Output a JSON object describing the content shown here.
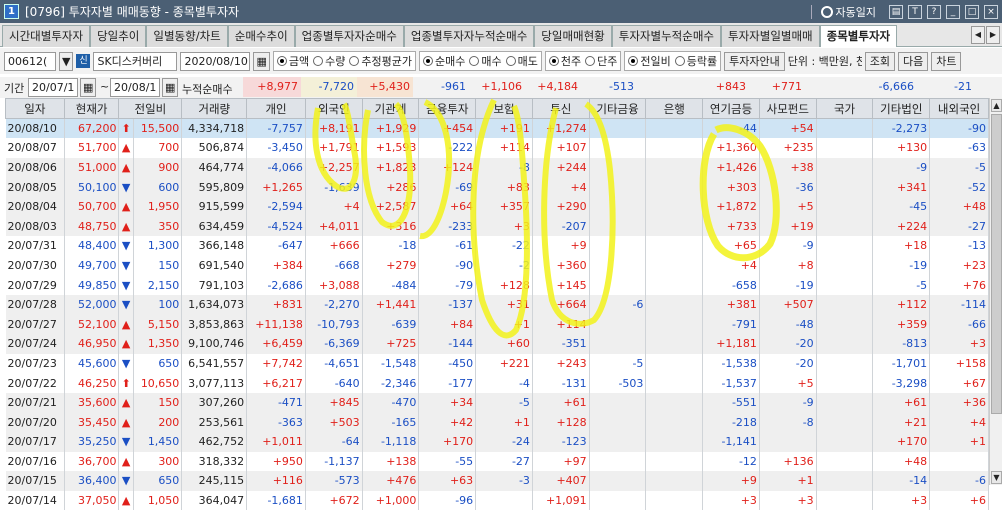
{
  "window": {
    "number": "1",
    "title": "[0796] 투자자별 매매동향 - 종목별투자자",
    "autolog": "자동일지",
    "buttons": [
      "T",
      "?",
      "_",
      "□",
      "×"
    ]
  },
  "tabs": [
    "시간대별투자자",
    "당일추이",
    "일별동향/차트",
    "순매수추이",
    "업종별투자자순매수",
    "업종별투자자누적순매수",
    "당일매매현황",
    "투자자별누적순매수",
    "투자자별일별매매",
    "종목별투자자"
  ],
  "active_tab": "종목별투자자",
  "controls": {
    "code": "00612(",
    "sin": "신",
    "stock_name": "SK디스커버리",
    "date": "2020/08/10",
    "mode_radios": [
      {
        "label": "금액",
        "on": true
      },
      {
        "label": "수량",
        "on": false
      },
      {
        "label": "추정평균가",
        "on": false
      }
    ],
    "side_radios": [
      {
        "label": "순매수",
        "on": true
      },
      {
        "label": "매수",
        "on": false
      },
      {
        "label": "매도",
        "on": false
      }
    ],
    "unit_radios": [
      {
        "label": "천주",
        "on": true
      },
      {
        "label": "단주",
        "on": false
      }
    ],
    "compare_radios": [
      {
        "label": "전일비",
        "on": true
      },
      {
        "label": "등락률",
        "on": false
      }
    ],
    "guide_btn": "투자자안내",
    "unit_text": "단위 : 백만원, 천주",
    "lookup_btn": "조회",
    "next_btn": "다음",
    "chart_btn": "차트"
  },
  "period": {
    "label": "기간",
    "from": "20/07/1",
    "to": "20/08/1",
    "net_label": "누적순매수"
  },
  "net_sums": [
    {
      "col": "개인",
      "v": "+8,977"
    },
    {
      "col": "외국인",
      "v": "-7,720"
    },
    {
      "col": "기관계",
      "v": "+5,430"
    },
    {
      "col": "금융투자",
      "v": "-961"
    },
    {
      "col": "보험",
      "v": "+1,106"
    },
    {
      "col": "투신",
      "v": "+4,184"
    },
    {
      "col": "기타금융",
      "v": "-513"
    },
    {
      "col": "은행",
      "v": ""
    },
    {
      "col": "연기금등",
      "v": "+843"
    },
    {
      "col": "사모펀드",
      "v": "+771"
    },
    {
      "col": "국가",
      "v": ""
    },
    {
      "col": "기타법인",
      "v": "-6,666"
    },
    {
      "col": "내외국인",
      "v": "-21"
    }
  ],
  "headers": [
    "일자",
    "현재가",
    "전일비",
    "거래량",
    "개인",
    "외국인",
    "기관계",
    "금융투자",
    "보험",
    "투신",
    "기타금융",
    "은행",
    "연기금등",
    "사모펀드",
    "국가",
    "기타법인",
    "내외국인"
  ],
  "rows": [
    [
      "20/08/10",
      "67,200",
      "up",
      "15,500",
      "4,334,718",
      "-7,757",
      "+8,191",
      "+1,929",
      "+454",
      "+191",
      "+1,274",
      "",
      "",
      "-44",
      "+54",
      "",
      "-2,273",
      "-90"
    ],
    [
      "20/08/07",
      "51,700",
      "upt",
      "700",
      "506,874",
      "-3,450",
      "+1,791",
      "+1,593",
      "-222",
      "+114",
      "+107",
      "",
      "",
      "+1,360",
      "+235",
      "",
      "+130",
      "-63"
    ],
    [
      "20/08/06",
      "51,000",
      "upt",
      "900",
      "464,774",
      "-4,066",
      "+2,257",
      "+1,823",
      "+124",
      "-8",
      "+244",
      "",
      "",
      "+1,426",
      "+38",
      "",
      "-9",
      "-5"
    ],
    [
      "20/08/05",
      "50,100",
      "dn",
      "600",
      "595,809",
      "+1,265",
      "-1,639",
      "+286",
      "-69",
      "+83",
      "+4",
      "",
      "",
      "+303",
      "-36",
      "",
      "+341",
      "-52"
    ],
    [
      "20/08/04",
      "50,700",
      "upt",
      "1,950",
      "915,599",
      "-2,594",
      "+4",
      "+2,587",
      "+64",
      "+357",
      "+290",
      "",
      "",
      "+1,872",
      "+5",
      "",
      "-45",
      "+48"
    ],
    [
      "20/08/03",
      "48,750",
      "upt",
      "350",
      "634,459",
      "-4,524",
      "+4,011",
      "+316",
      "-233",
      "+3",
      "-207",
      "",
      "",
      "+733",
      "+19",
      "",
      "+224",
      "-27"
    ],
    [
      "20/07/31",
      "48,400",
      "dn",
      "1,300",
      "366,148",
      "-647",
      "+666",
      "-18",
      "-61",
      "-22",
      "+9",
      "",
      "",
      "+65",
      "-9",
      "",
      "+18",
      "-13"
    ],
    [
      "20/07/30",
      "49,700",
      "dn",
      "150",
      "691,540",
      "+384",
      "-668",
      "+279",
      "-90",
      "-2",
      "+360",
      "",
      "",
      "+4",
      "+8",
      "",
      "-19",
      "+23"
    ],
    [
      "20/07/29",
      "49,850",
      "dn",
      "2,150",
      "791,103",
      "-2,686",
      "+3,088",
      "-484",
      "-79",
      "+128",
      "+145",
      "",
      "",
      "-658",
      "-19",
      "",
      "-5",
      "+76"
    ],
    [
      "20/07/28",
      "52,000",
      "dn",
      "100",
      "1,634,073",
      "+831",
      "-2,270",
      "+1,441",
      "-137",
      "+31",
      "+664",
      "-6",
      "",
      "+381",
      "+507",
      "",
      "+112",
      "-114"
    ],
    [
      "20/07/27",
      "52,100",
      "upt",
      "5,150",
      "3,853,863",
      "+11,138",
      "-10,793",
      "-639",
      "+84",
      "+1",
      "+114",
      "",
      "",
      "-791",
      "-48",
      "",
      "+359",
      "-66"
    ],
    [
      "20/07/24",
      "46,950",
      "upt",
      "1,350",
      "9,100,746",
      "+6,459",
      "-6,369",
      "+725",
      "-144",
      "+60",
      "-351",
      "",
      "",
      "+1,181",
      "-20",
      "",
      "-813",
      "+3"
    ],
    [
      "20/07/23",
      "45,600",
      "dn",
      "650",
      "6,541,557",
      "+7,742",
      "-4,651",
      "-1,548",
      "-450",
      "+221",
      "+243",
      "-5",
      "",
      "-1,538",
      "-20",
      "",
      "-1,701",
      "+158"
    ],
    [
      "20/07/22",
      "46,250",
      "up",
      "10,650",
      "3,077,113",
      "+6,217",
      "-640",
      "-2,346",
      "-177",
      "-4",
      "-131",
      "-503",
      "",
      "-1,537",
      "+5",
      "",
      "-3,298",
      "+67"
    ],
    [
      "20/07/21",
      "35,600",
      "upt",
      "150",
      "307,260",
      "-471",
      "+845",
      "-470",
      "+34",
      "-5",
      "+61",
      "",
      "",
      "-551",
      "-9",
      "",
      "+61",
      "+36"
    ],
    [
      "20/07/20",
      "35,450",
      "upt",
      "200",
      "253,561",
      "-363",
      "+503",
      "-165",
      "+42",
      "+1",
      "+128",
      "",
      "",
      "-218",
      "-8",
      "",
      "+21",
      "+4"
    ],
    [
      "20/07/17",
      "35,250",
      "dn",
      "1,450",
      "462,752",
      "+1,011",
      "-64",
      "-1,118",
      "+170",
      "-24",
      "-123",
      "",
      "",
      "-1,141",
      "",
      "",
      "+170",
      "+1"
    ],
    [
      "20/07/16",
      "36,700",
      "upt",
      "300",
      "318,332",
      "+950",
      "-1,137",
      "+138",
      "-55",
      "-27",
      "+97",
      "",
      "",
      "-12",
      "+136",
      "",
      "+48",
      ""
    ],
    [
      "20/07/15",
      "36,400",
      "dn",
      "650",
      "245,115",
      "+116",
      "-573",
      "+476",
      "+63",
      "-3",
      "+407",
      "",
      "",
      "+9",
      "+1",
      "",
      "-14",
      "-6"
    ],
    [
      "20/07/14",
      "37,050",
      "upt",
      "1,050",
      "364,047",
      "-1,681",
      "+672",
      "+1,000",
      "-96",
      "",
      "+1,091",
      "",
      "",
      "+3",
      "+3",
      "",
      "+3",
      "+6"
    ]
  ],
  "colors": {
    "up": "#e0201a",
    "down": "#1b4fc4",
    "selected_row": "#cfe4f4",
    "highlight": "#f2f21a"
  }
}
